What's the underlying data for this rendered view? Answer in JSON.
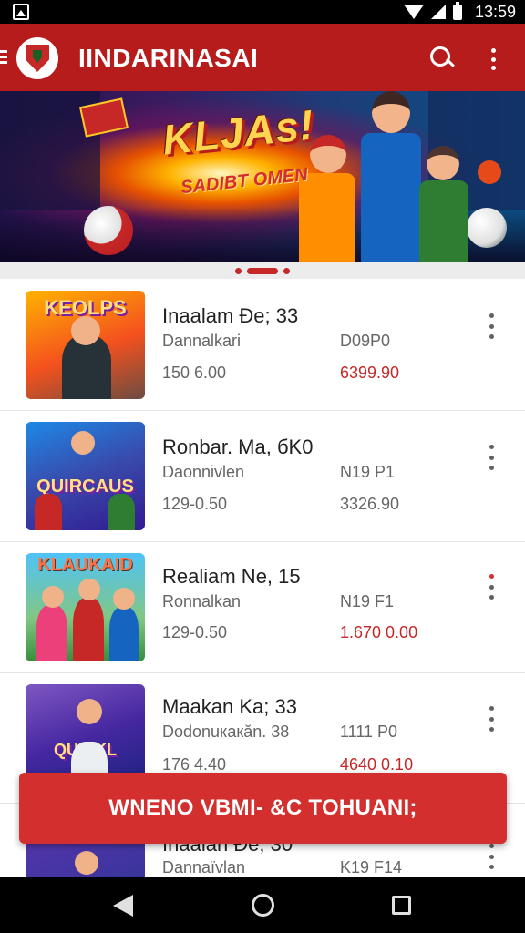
{
  "status_bar": {
    "time": "13:59"
  },
  "app_bar": {
    "title": "IINDARINASAI"
  },
  "banner": {
    "title": "KLJAs!",
    "subtitle": "SADIBT OMEN"
  },
  "items": [
    {
      "thumb_label": "KEOLPS",
      "title": "Inaalam Ðe; 33",
      "subtitle": "Dannalkari",
      "meta": "D09P0",
      "date": "150 6.00",
      "price": "6399.90",
      "price_color": "red"
    },
    {
      "thumb_label": "QUIRCAUS",
      "title": "Ronbar. Ma, бK0",
      "subtitle": "Daonnivlen",
      "meta": "N19 P1",
      "date": "129-0.50",
      "price": "3326.90",
      "price_color": "gray"
    },
    {
      "thumb_label": "KLAUKAID",
      "title": "Realiam Ne, 15",
      "subtitle": "Ronnalkan",
      "meta": "N19 F1",
      "date": "129-0.50",
      "price": "1.670 0.00",
      "price_color": "red"
    },
    {
      "thumb_label": "QUIRKL",
      "title": "Maakan Ka; 33",
      "subtitle": "Dodonuкакăn. 38",
      "meta": "1111 P0",
      "date": "176 4.40",
      "price": "4640 0.10",
      "price_color": "red"
    },
    {
      "thumb_label": "",
      "title": "Inaalan Ðe; 30",
      "subtitle": "Dannaïvlan",
      "meta": "K19 F14",
      "date": "",
      "price": "",
      "price_color": "gray"
    }
  ],
  "cta": {
    "label": "WNENO VBMI- &C TOHUANI;"
  },
  "colors": {
    "primary": "#b71c1c",
    "accent": "#d32f2f"
  }
}
